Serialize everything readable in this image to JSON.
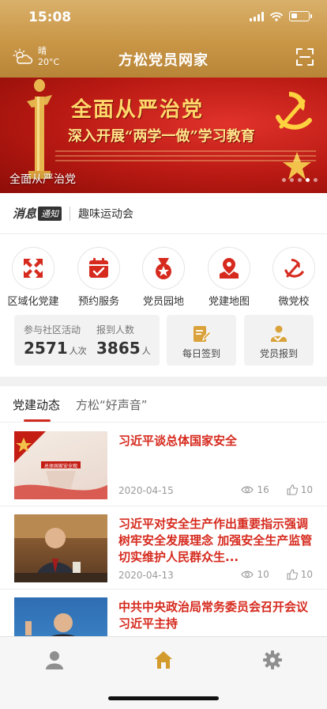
{
  "status_bar": {
    "time": "15:08"
  },
  "header": {
    "title": "方松党员网家",
    "weather": {
      "condition": "晴",
      "temperature": "20°C"
    }
  },
  "banner": {
    "title": "全面从严治党",
    "subtitle": "深入开展“两学一做”学习教育",
    "caption": "全面从严治党",
    "slide_count": 5,
    "active_slide": 4
  },
  "notice": {
    "label": "消息",
    "badge": "通知",
    "text": "趣味运动会"
  },
  "quick_menu": [
    {
      "label": "区域化党建",
      "icon": "regional-party-icon"
    },
    {
      "label": "预约服务",
      "icon": "calendar-check-icon"
    },
    {
      "label": "党员园地",
      "icon": "medal-star-icon"
    },
    {
      "label": "党建地图",
      "icon": "map-pin-icon"
    },
    {
      "label": "微党校",
      "icon": "party-emblem-icon"
    }
  ],
  "stats": {
    "activity": {
      "label": "参与社区活动",
      "value": "2571",
      "unit": "人次"
    },
    "registered": {
      "label": "报到人数",
      "value": "3865",
      "unit": "人"
    }
  },
  "actions": {
    "sign_in": {
      "label": "每日签到",
      "icon": "edit-note-icon"
    },
    "report": {
      "label": "党员报到",
      "icon": "member-check-icon"
    }
  },
  "tabs": [
    {
      "label": "党建动态"
    },
    {
      "label": "方松“好声音”"
    }
  ],
  "news": [
    {
      "title": "习近平谈总体国家安全",
      "thumb_text": "总体国家安全观",
      "date": "2020-04-15",
      "views": "16",
      "likes": "10"
    },
    {
      "title": "习近平对安全生产作出重要指示强调 树牢安全发展理念 加强安全生产监管 切实维护人民群众生...",
      "date": "2020-04-13",
      "views": "10",
      "likes": "10"
    },
    {
      "title": "中共中央政治局常务委员会召开会议 习近平主持"
    }
  ],
  "tabbar": [
    {
      "icon": "user-icon"
    },
    {
      "icon": "home-icon"
    },
    {
      "icon": "settings-gear-icon"
    }
  ],
  "colors": {
    "header_gold": "#c99646",
    "party_red": "#d62a1e",
    "tab_active_gold": "#d39a2c"
  }
}
